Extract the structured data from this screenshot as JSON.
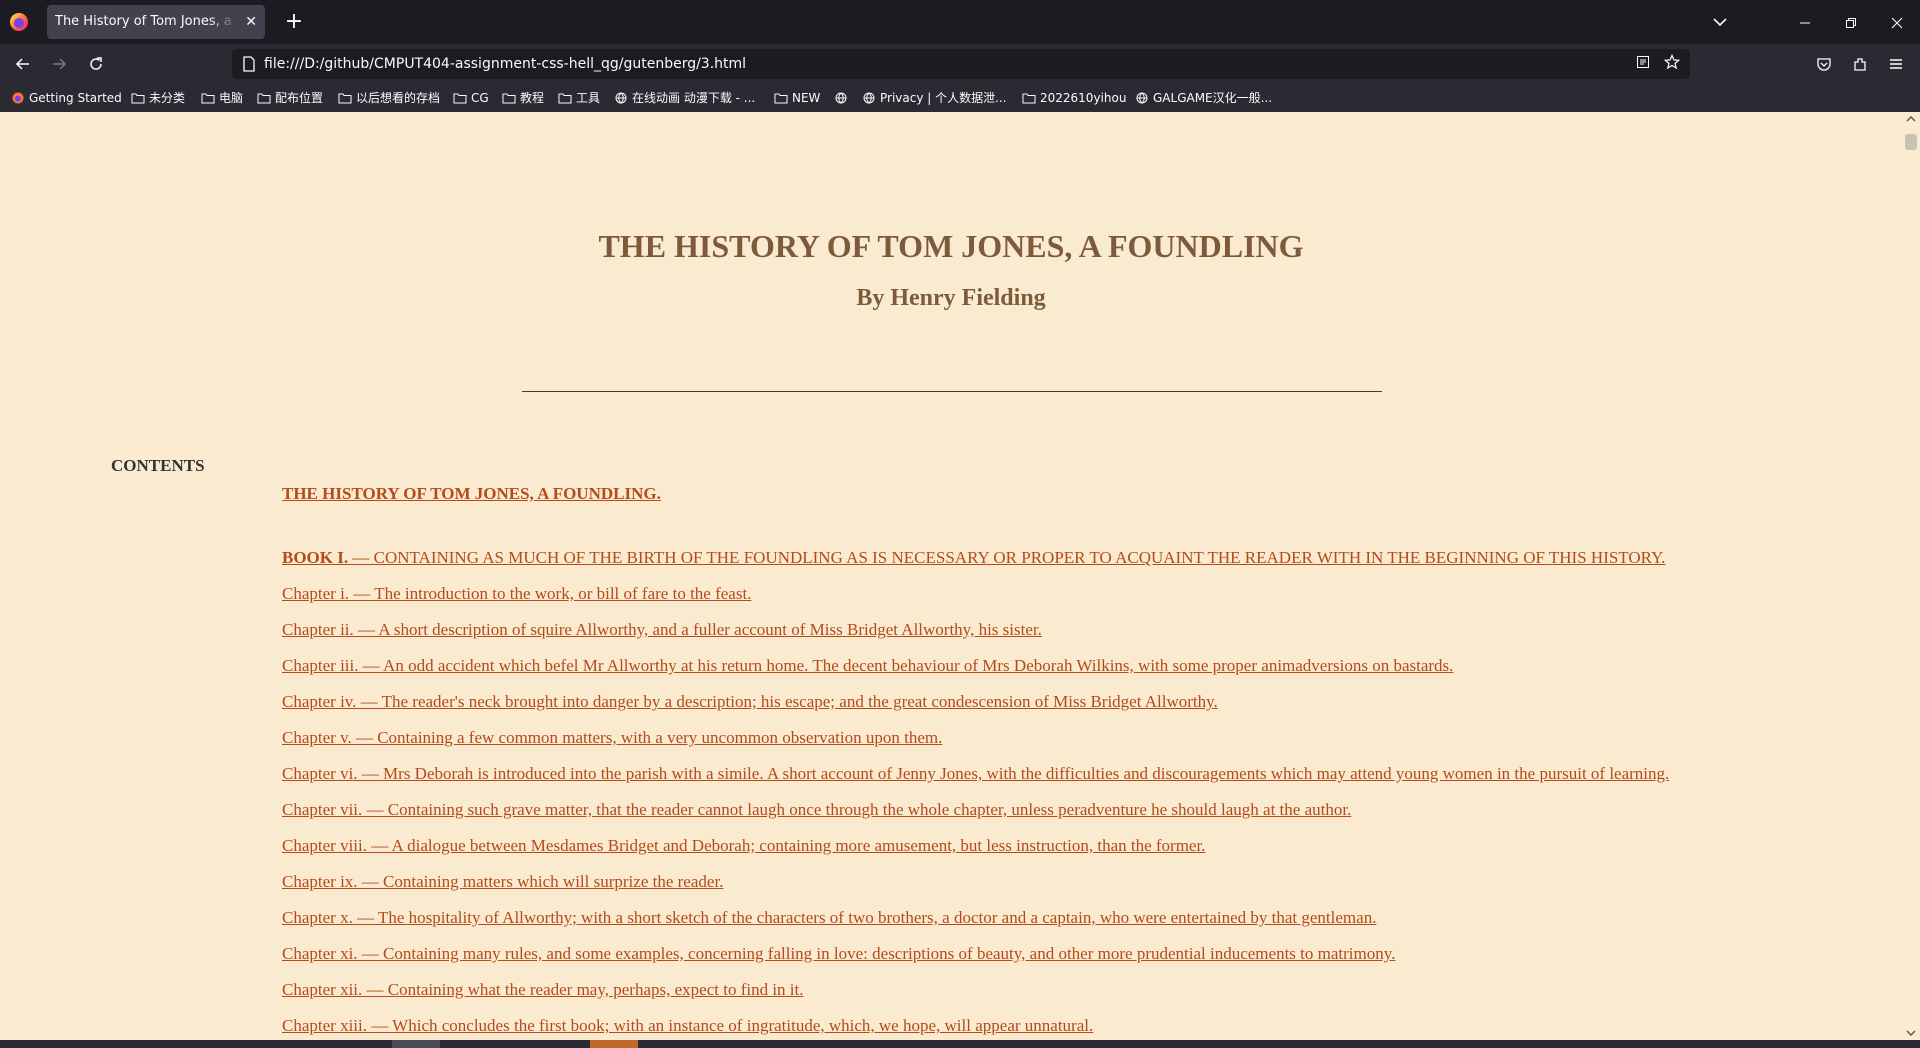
{
  "browser": {
    "tab_title": "The History of Tom Jones, a Foundling",
    "tab_close": "✕",
    "new_tab": "+",
    "url": "file:///D:/github/CMPUT404-assignment-css-hell_qg/gutenberg/3.html",
    "icons": [
      "firefox-icon",
      "back-icon",
      "forward-icon",
      "reload-icon",
      "page-icon",
      "reader-view-icon",
      "bookmark-star-icon",
      "pocket-icon",
      "extensions-icon",
      "menu-icon"
    ]
  },
  "bookmarks": [
    {
      "label": "Getting Started",
      "icon": "firefox-icon"
    },
    {
      "label": "未分类",
      "icon": "folder-icon"
    },
    {
      "label": "电脑",
      "icon": "folder-icon"
    },
    {
      "label": "配布位置",
      "icon": "folder-icon"
    },
    {
      "label": "以后想看的存档",
      "icon": "folder-icon"
    },
    {
      "label": "CG",
      "icon": "folder-icon"
    },
    {
      "label": "教程",
      "icon": "folder-icon"
    },
    {
      "label": "工具",
      "icon": "folder-icon"
    },
    {
      "label": "在线动画 动漫下载 - ...",
      "icon": "globe-icon"
    },
    {
      "label": "NEW",
      "icon": "folder-icon"
    },
    {
      "label": "",
      "icon": "globe-icon"
    },
    {
      "label": "Privacy | 个人数据泄...",
      "icon": "globe-icon"
    },
    {
      "label": "2022610yihou",
      "icon": "folder-icon"
    },
    {
      "label": "GALGAME汉化一般...",
      "icon": "globe-icon"
    }
  ],
  "page": {
    "title": "THE HISTORY OF TOM JONES, A FOUNDLING",
    "author": "By Henry Fielding",
    "contents_label": "CONTENTS",
    "toc_main": "THE HISTORY OF TOM JONES, A FOUNDLING.",
    "book": {
      "label": "BOOK I.",
      "text": " — CONTAINING AS MUCH OF THE BIRTH OF THE FOUNDLING AS IS NECESSARY OR PROPER TO ACQUAINT THE READER WITH IN THE BEGINNING OF THIS HISTORY."
    },
    "chapters": [
      "Chapter i. — The introduction to the work, or bill of fare to the feast.",
      "Chapter ii. — A short description of squire Allworthy, and a fuller account of Miss Bridget Allworthy, his sister.",
      "Chapter iii. — An odd accident which befel Mr Allworthy at his return home. The decent behaviour of Mrs Deborah Wilkins, with some proper animadversions on bastards.",
      "Chapter iv. — The reader's neck brought into danger by a description; his escape; and the great condescension of Miss Bridget Allworthy.",
      "Chapter v. — Containing a few common matters, with a very uncommon observation upon them.",
      "Chapter vi. — Mrs Deborah is introduced into the parish with a simile. A short account of Jenny Jones, with the difficulties and discouragements which may attend young women in the pursuit of learning.",
      "Chapter vii. — Containing such grave matter, that the reader cannot laugh once through the whole chapter, unless peradventure he should laugh at the author.",
      "Chapter viii. — A dialogue between Mesdames Bridget and Deborah; containing more amusement, but less instruction, than the former.",
      "Chapter ix. — Containing matters which will surprize the reader.",
      "Chapter x. — The hospitality of Allworthy; with a short sketch of the characters of two brothers, a doctor and a captain, who were entertained by that gentleman.",
      "Chapter xi. — Containing many rules, and some examples, concerning falling in love: descriptions of beauty, and other more prudential inducements to matrimony.",
      "Chapter xii. — Containing what the reader may, perhaps, expect to find in it.",
      "Chapter xiii. — Which concludes the first book; with an instance of ingratitude, which, we hope, will appear unnatural."
    ]
  },
  "colors": {
    "page_bg": "#faebd0",
    "heading": "#7d5b3a",
    "link": "#b54a1a",
    "chrome_dark": "#1c1b22",
    "chrome": "#2b2a33"
  }
}
